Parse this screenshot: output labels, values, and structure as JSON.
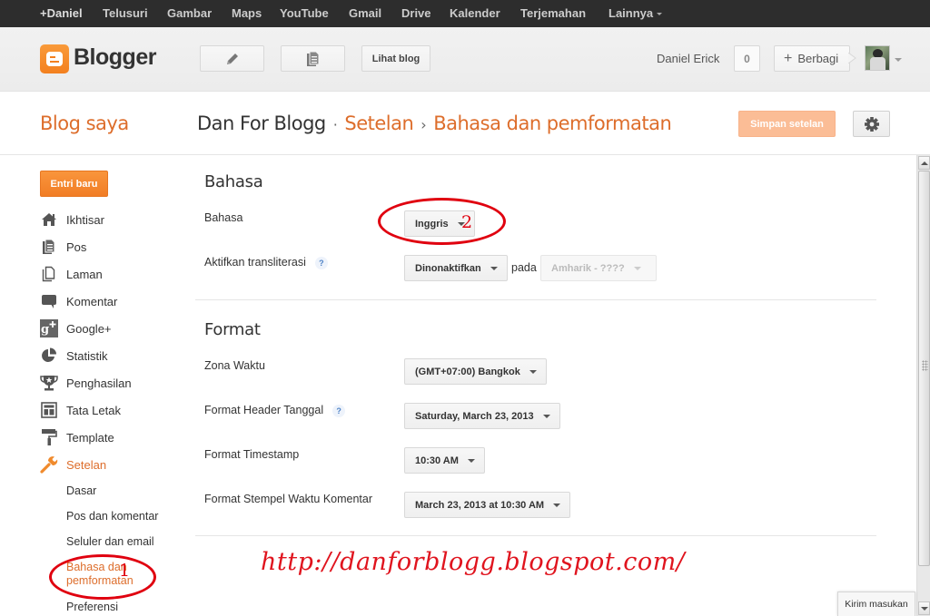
{
  "google_bar": {
    "items": [
      "+Daniel",
      "Telusuri",
      "Gambar",
      "Maps",
      "YouTube",
      "Gmail",
      "Drive",
      "Kalender",
      "Terjemahan",
      "Lainnya"
    ]
  },
  "header": {
    "brand": "Blogger",
    "new_post_icon": "pencil-icon",
    "posts_icon": "posts-icon",
    "view_blog_label": "Lihat blog",
    "user_name": "Daniel Erick",
    "notification_count": "0",
    "share_label": "Berbagi"
  },
  "titlebar": {
    "my_blogs": "Blog saya",
    "breadcrumb": {
      "blog_name": "Dan For Blogg",
      "dot": "·",
      "section": "Setelan",
      "arrow": "›",
      "page": "Bahasa dan pemformatan"
    },
    "save_label": "Simpan setelan"
  },
  "sidebar": {
    "new_entry_label": "Entri baru",
    "items": [
      {
        "label": "Ikhtisar",
        "icon": "home-icon"
      },
      {
        "label": "Pos",
        "icon": "posts-icon"
      },
      {
        "label": "Laman",
        "icon": "pages-icon"
      },
      {
        "label": "Komentar",
        "icon": "comment-icon"
      },
      {
        "label": "Google+",
        "icon": "google-plus-icon"
      },
      {
        "label": "Statistik",
        "icon": "pie-chart-icon"
      },
      {
        "label": "Penghasilan",
        "icon": "trophy-icon"
      },
      {
        "label": "Tata Letak",
        "icon": "layout-icon"
      },
      {
        "label": "Template",
        "icon": "paint-roller-icon"
      },
      {
        "label": "Setelan",
        "icon": "wrench-icon",
        "active": true
      }
    ],
    "sub_items": [
      {
        "label": "Dasar"
      },
      {
        "label": "Pos dan komentar"
      },
      {
        "label": "Seluler dan email"
      },
      {
        "label": "Bahasa dan pemformatan",
        "label_line1": "Bahasa dan",
        "label_line2": "pemformatan",
        "active": true
      },
      {
        "label": "Preferensi"
      }
    ]
  },
  "main": {
    "language_section": {
      "heading": "Bahasa",
      "language_label": "Bahasa",
      "language_value": "Inggris",
      "transliteration_label": "Aktifkan transliterasi",
      "help": "?",
      "transliteration_value": "Dinonaktifkan",
      "on_label": "pada",
      "transliteration_lang_value": "Amharik - ????"
    },
    "format_section": {
      "heading": "Format",
      "timezone_label": "Zona Waktu",
      "timezone_value": "(GMT+07:00) Bangkok",
      "date_header_label": "Format Header Tanggal",
      "help": "?",
      "date_header_value": "Saturday, March 23, 2013",
      "timestamp_label": "Format Timestamp",
      "timestamp_value": "10:30 AM",
      "comment_timestamp_label": "Format Stempel Waktu Komentar",
      "comment_timestamp_value": "March 23, 2013 at 10:30 AM"
    }
  },
  "annotations": {
    "marker_1": "1",
    "marker_2": "2",
    "watermark": "http://danforblogg.blogspot.com/",
    "color": "#e0000f"
  },
  "feedback_label": "Kirim masukan",
  "colors": {
    "accent_orange": "#dd6d2b",
    "primary_button": "#f17d25",
    "disabled_save": "#fbbd96"
  }
}
